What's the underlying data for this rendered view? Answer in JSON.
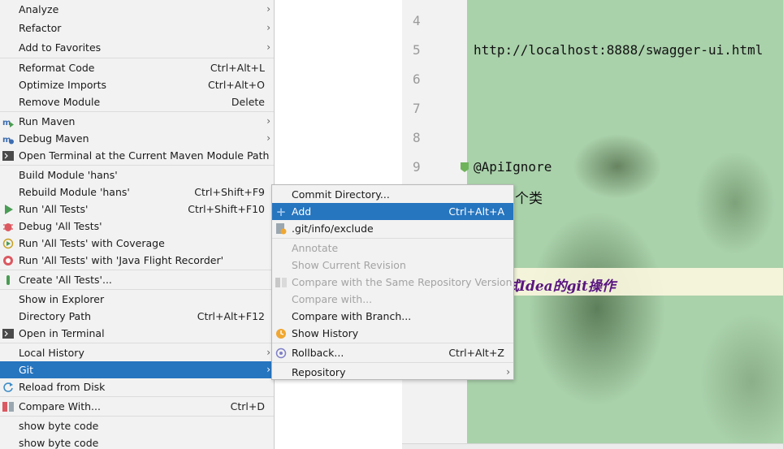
{
  "main_menu": {
    "items": [
      {
        "label": "Analyze",
        "shortcut": "",
        "submenu": true
      },
      {
        "label": "Refactor",
        "shortcut": "",
        "submenu": true
      },
      {
        "label": "Add to Favorites",
        "shortcut": "",
        "submenu": true
      },
      {
        "label": "Reformat Code",
        "shortcut": "Ctrl+Alt+L"
      },
      {
        "label": "Optimize Imports",
        "shortcut": "Ctrl+Alt+O"
      },
      {
        "label": "Remove Module",
        "shortcut": "Delete"
      },
      {
        "label": "Run Maven",
        "shortcut": "",
        "submenu": true,
        "icon": "maven-run-icon"
      },
      {
        "label": "Debug Maven",
        "shortcut": "",
        "submenu": true,
        "icon": "maven-debug-icon"
      },
      {
        "label": "Open Terminal at the Current Maven Module Path",
        "shortcut": "",
        "icon": "terminal-icon"
      },
      {
        "label": "Build Module 'hans'",
        "shortcut": ""
      },
      {
        "label": "Rebuild Module 'hans'",
        "shortcut": "Ctrl+Shift+F9"
      },
      {
        "label": "Run 'All Tests'",
        "shortcut": "Ctrl+Shift+F10",
        "icon": "run-icon"
      },
      {
        "label": "Debug 'All Tests'",
        "shortcut": "",
        "icon": "debug-icon"
      },
      {
        "label": "Run 'All Tests' with Coverage",
        "shortcut": "",
        "icon": "coverage-icon"
      },
      {
        "label": "Run 'All Tests' with 'Java Flight Recorder'",
        "shortcut": "",
        "icon": "profiler-icon"
      },
      {
        "label": "Create 'All Tests'...",
        "shortcut": "",
        "icon": "test-create-icon"
      },
      {
        "label": "Show in Explorer",
        "shortcut": ""
      },
      {
        "label": "Directory Path",
        "shortcut": "Ctrl+Alt+F12"
      },
      {
        "label": "Open in Terminal",
        "shortcut": "",
        "icon": "terminal-icon"
      },
      {
        "label": "Local History",
        "shortcut": "",
        "submenu": true
      },
      {
        "label": "Git",
        "shortcut": "",
        "submenu": true,
        "selected": true
      },
      {
        "label": "Reload from Disk",
        "shortcut": "",
        "icon": "reload-icon"
      },
      {
        "label": "Compare With...",
        "shortcut": "Ctrl+D",
        "icon": "compare-icon"
      },
      {
        "label": "show byte code",
        "shortcut": ""
      },
      {
        "label": "show byte code",
        "shortcut": ""
      }
    ]
  },
  "git_menu": {
    "items": [
      {
        "label": "Commit Directory...",
        "shortcut": ""
      },
      {
        "label": "Add",
        "shortcut": "Ctrl+Alt+A",
        "selected": true,
        "icon": "plus-icon"
      },
      {
        "label": ".git/info/exclude",
        "shortcut": "",
        "icon": "git-file-icon"
      },
      {
        "label": "Annotate",
        "shortcut": "",
        "disabled": true
      },
      {
        "label": "Show Current Revision",
        "shortcut": "",
        "disabled": true
      },
      {
        "label": "Compare with the Same Repository Version",
        "shortcut": "",
        "disabled": true,
        "icon": "compare-icon"
      },
      {
        "label": "Compare with...",
        "shortcut": "",
        "disabled": true
      },
      {
        "label": "Compare with Branch...",
        "shortcut": ""
      },
      {
        "label": "Show History",
        "shortcut": "",
        "icon": "history-icon"
      },
      {
        "label": "Rollback...",
        "shortcut": "Ctrl+Alt+Z",
        "icon": "rollback-icon"
      },
      {
        "label": "Repository",
        "shortcut": "",
        "submenu": true
      }
    ]
  },
  "editor": {
    "line_numbers": [
      "4",
      "5",
      "6",
      "7",
      "8",
      "9"
    ],
    "url_line": "http://localhost:8888/swagger-ui.html",
    "annotation_line": "@ApiIgnore",
    "comment_line": "某个类",
    "italic_line": "试Idea的git操作"
  },
  "glyphs": {
    "submenu_arrow": "›"
  },
  "colors": {
    "selection": "#2675bf",
    "menu_bg": "#f2f2f2",
    "editor_bg": "#a9d1aa",
    "disabled_text": "#a3a3a3"
  }
}
